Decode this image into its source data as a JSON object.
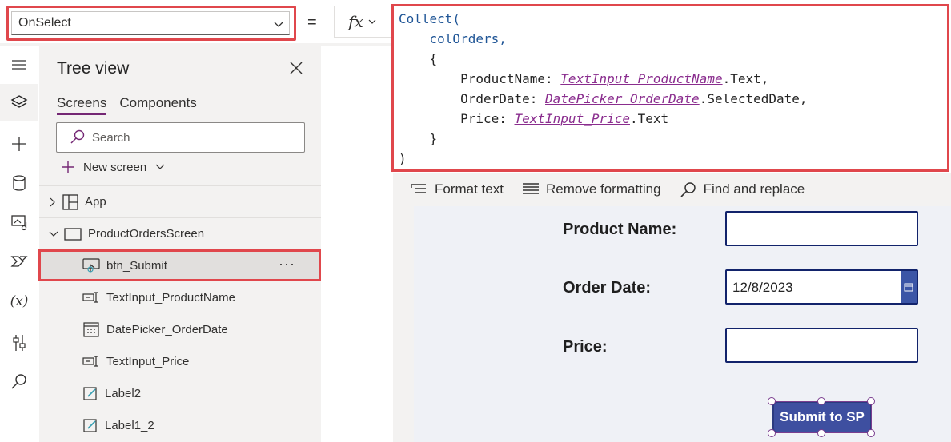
{
  "formula_bar": {
    "property": "OnSelect",
    "equals": "=",
    "fx_label": "fx",
    "code_lines": [
      {
        "indent": "",
        "parts": [
          {
            "t": "Collect(",
            "c": "fn"
          }
        ]
      },
      {
        "indent": "    ",
        "parts": [
          {
            "t": "colOrders",
            "c": "id"
          },
          {
            "t": ",",
            "c": "id"
          }
        ]
      },
      {
        "indent": "    ",
        "parts": [
          {
            "t": "{",
            "c": "plain"
          }
        ]
      },
      {
        "indent": "        ",
        "parts": [
          {
            "t": "ProductName: ",
            "c": "plain"
          },
          {
            "t": "TextInput_ProductName",
            "c": "ctl"
          },
          {
            "t": ".Text,",
            "c": "plain"
          }
        ]
      },
      {
        "indent": "        ",
        "parts": [
          {
            "t": "OrderDate: ",
            "c": "plain"
          },
          {
            "t": "DatePicker_OrderDate",
            "c": "ctl"
          },
          {
            "t": ".SelectedDate,",
            "c": "plain"
          }
        ]
      },
      {
        "indent": "        ",
        "parts": [
          {
            "t": "Price: ",
            "c": "plain"
          },
          {
            "t": "TextInput_Price",
            "c": "ctl"
          },
          {
            "t": ".Text",
            "c": "plain"
          }
        ]
      },
      {
        "indent": "    ",
        "parts": [
          {
            "t": "}",
            "c": "plain"
          }
        ]
      },
      {
        "indent": "",
        "parts": [
          {
            "t": ")",
            "c": "plain"
          }
        ]
      }
    ]
  },
  "format_toolbar": {
    "format_text": "Format text",
    "remove_formatting": "Remove formatting",
    "find_replace": "Find and replace"
  },
  "rail": {
    "icons": [
      "hamburger-icon",
      "layers-icon",
      "plus-icon",
      "database-icon",
      "media-icon",
      "power-automate-icon",
      "variables-icon",
      "tools-icon",
      "search-icon"
    ],
    "variables_glyph": "(x)"
  },
  "tree": {
    "title": "Tree view",
    "tabs": [
      "Screens",
      "Components"
    ],
    "search_placeholder": "Search",
    "new_screen": "New screen",
    "app_label": "App",
    "screen_label": "ProductOrdersScreen",
    "items": [
      {
        "label": "btn_Submit",
        "icon": "button-icon",
        "selected": true
      },
      {
        "label": "TextInput_ProductName",
        "icon": "text-input-icon",
        "selected": false
      },
      {
        "label": "DatePicker_OrderDate",
        "icon": "calendar-icon",
        "selected": false
      },
      {
        "label": "TextInput_Price",
        "icon": "text-input-icon",
        "selected": false
      },
      {
        "label": "Label2",
        "icon": "label-icon",
        "selected": false
      },
      {
        "label": "Label1_2",
        "icon": "label-icon",
        "selected": false
      }
    ],
    "more": "···"
  },
  "form": {
    "product_name_label": "Product Name:",
    "product_name_value": "",
    "order_date_label": "Order Date:",
    "order_date_value": "12/8/2023",
    "price_label": "Price:",
    "price_value": "",
    "submit_label": "Submit to SP"
  },
  "colors": {
    "highlight_red": "#e0474c",
    "control_purple": "#8a2d8e",
    "code_blue": "#1f5596",
    "button_blue": "#3e4fa0",
    "input_border": "#12236b",
    "tab_underline": "#742774"
  }
}
